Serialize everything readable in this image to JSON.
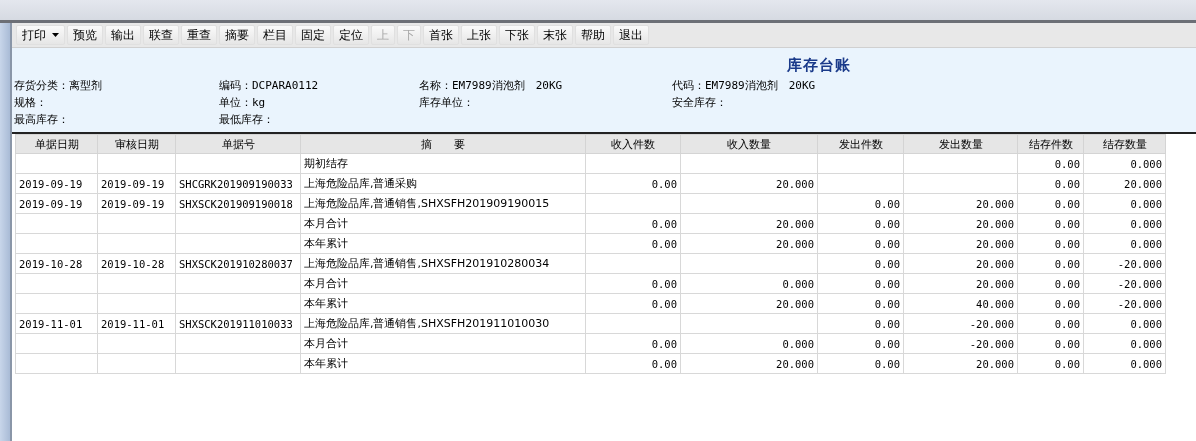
{
  "toolbar": [
    {
      "label": "打印",
      "dropdown": true,
      "disabled": false
    },
    {
      "label": "预览",
      "disabled": false
    },
    {
      "label": "输出",
      "disabled": false
    },
    {
      "label": "联查",
      "disabled": false
    },
    {
      "label": "重查",
      "disabled": false
    },
    {
      "label": "摘要",
      "disabled": false
    },
    {
      "label": "栏目",
      "disabled": false
    },
    {
      "label": "固定",
      "disabled": false
    },
    {
      "label": "定位",
      "disabled": false
    },
    {
      "label": "上",
      "disabled": true
    },
    {
      "label": "下",
      "disabled": true
    },
    {
      "label": "首张",
      "disabled": false
    },
    {
      "label": "上张",
      "disabled": false
    },
    {
      "label": "下张",
      "disabled": false
    },
    {
      "label": "末张",
      "disabled": false
    },
    {
      "label": "帮助",
      "disabled": false
    },
    {
      "label": "退出",
      "disabled": false
    }
  ],
  "report_title": "库存台账",
  "info_fields": [
    {
      "label": "存货分类：",
      "value": "离型剂"
    },
    {
      "label": "编码：",
      "value": "DCPARA0112"
    },
    {
      "label": "名称：",
      "value": "EM7989消泡剂　20KG"
    },
    {
      "label": "代码：",
      "value": "EM7989消泡剂　20KG"
    },
    {
      "label": "规格："
    },
    {
      "label": "单位：",
      "value": "kg"
    },
    {
      "label": "库存单位："
    },
    {
      "label": "安全库存："
    },
    {
      "label": "最高库存："
    },
    {
      "label": "最低库存："
    }
  ],
  "table": {
    "columns": [
      "单据日期",
      "审核日期",
      "单据号",
      "摘　　要",
      "收入件数",
      "收入数量",
      "发出件数",
      "发出数量",
      "结存件数",
      "结存数量"
    ],
    "rows": [
      [
        null,
        null,
        null,
        "期初结存",
        null,
        null,
        null,
        null,
        "0.00",
        "0.000"
      ],
      [
        "2019-09-19",
        "2019-09-19",
        "SHCGRK201909190033",
        "上海危险品库,普通采购",
        "0.00",
        "20.000",
        null,
        null,
        "0.00",
        "20.000"
      ],
      [
        "2019-09-19",
        "2019-09-19",
        "SHXSCK201909190018",
        "上海危险品库,普通销售,SHXSFH201909190015",
        null,
        null,
        "0.00",
        "20.000",
        "0.00",
        "0.000"
      ],
      [
        null,
        null,
        null,
        "本月合计",
        "0.00",
        "20.000",
        "0.00",
        "20.000",
        "0.00",
        "0.000"
      ],
      [
        null,
        null,
        null,
        "本年累计",
        "0.00",
        "20.000",
        "0.00",
        "20.000",
        "0.00",
        "0.000"
      ],
      [
        "2019-10-28",
        "2019-10-28",
        "SHXSCK201910280037",
        "上海危险品库,普通销售,SHXSFH201910280034",
        null,
        null,
        "0.00",
        "20.000",
        "0.00",
        "-20.000"
      ],
      [
        null,
        null,
        null,
        "本月合计",
        "0.00",
        "0.000",
        "0.00",
        "20.000",
        "0.00",
        "-20.000"
      ],
      [
        null,
        null,
        null,
        "本年累计",
        "0.00",
        "20.000",
        "0.00",
        "40.000",
        "0.00",
        "-20.000"
      ],
      [
        "2019-11-01",
        "2019-11-01",
        "SHXSCK201911010033",
        "上海危险品库,普通销售,SHXSFH201911010030",
        null,
        null,
        "0.00",
        "-20.000",
        "0.00",
        "0.000"
      ],
      [
        null,
        null,
        null,
        "本月合计",
        "0.00",
        "0.000",
        "0.00",
        "-20.000",
        "0.00",
        "0.000"
      ],
      [
        null,
        null,
        null,
        "本年累计",
        "0.00",
        "20.000",
        "0.00",
        "20.000",
        "0.00",
        "0.000"
      ]
    ]
  }
}
